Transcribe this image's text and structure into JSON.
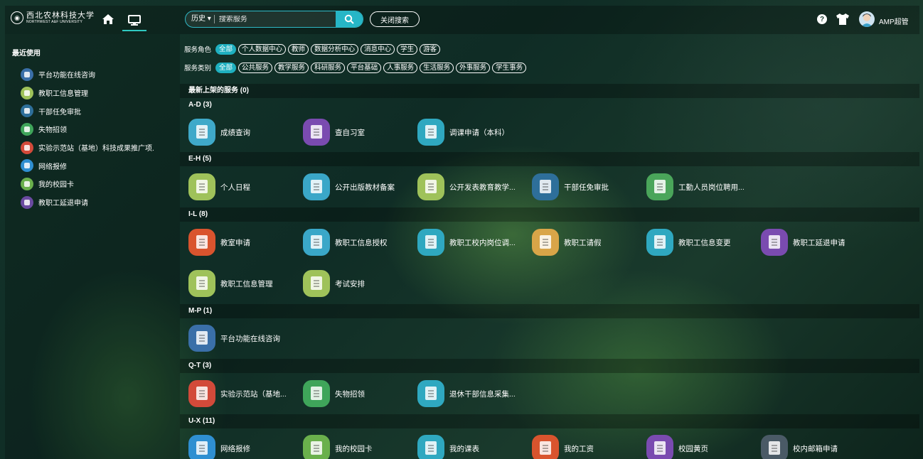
{
  "header": {
    "logo_cn": "西北农林科技大学",
    "logo_en": "NORTHWEST A&F UNIVERSITY",
    "history_label": "历史",
    "search_placeholder": "搜索服务",
    "close_search_label": "关闭搜索",
    "username": "AMP超管"
  },
  "sidebar": {
    "title": "最近使用",
    "items": [
      {
        "label": "平台功能在线咨询",
        "color": "#3a6fa8"
      },
      {
        "label": "教职工信息管理",
        "color": "#9fc25a"
      },
      {
        "label": "干部任免审批",
        "color": "#2e6f9a"
      },
      {
        "label": "失物招领",
        "color": "#3fa55a"
      },
      {
        "label": "实验示范站（基地）科技成果推广项.",
        "color": "#d24a3a"
      },
      {
        "label": "网络报修",
        "color": "#2f8fd1"
      },
      {
        "label": "我的校园卡",
        "color": "#6ab04c"
      },
      {
        "label": "教职工延退申请",
        "color": "#6a4aa0"
      }
    ]
  },
  "filters": {
    "role_label": "服务角色",
    "roles": [
      "全部",
      "个人数据中心",
      "教师",
      "数据分析中心",
      "消息中心",
      "学生",
      "游客"
    ],
    "type_label": "服务类别",
    "types": [
      "全部",
      "公共服务",
      "教学服务",
      "科研服务",
      "平台基础",
      "人事服务",
      "生活服务",
      "外事服务",
      "学生事务"
    ]
  },
  "sections": {
    "latest": "最新上架的服务 (0)",
    "ad": "A-D (3)",
    "eh": "E-H (5)",
    "il": "I-L (8)",
    "mp": "M-P (1)",
    "qt": "Q-T (3)",
    "ux": "U-X (11)"
  },
  "apps": {
    "ad": [
      {
        "label": "成绩查询",
        "color": "#3fa9c9"
      },
      {
        "label": "查自习室",
        "color": "#7a4bb0"
      },
      {
        "label": "调课申请（本科）",
        "color": "#2fa8c0"
      }
    ],
    "eh": [
      {
        "label": "个人日程",
        "color": "#9fc25a"
      },
      {
        "label": "公开出版教材备案",
        "color": "#3aa7c8"
      },
      {
        "label": "公开发表教育教学...",
        "color": "#9fc25a"
      },
      {
        "label": "干部任免审批",
        "color": "#2e6f9a"
      },
      {
        "label": "工勤人员岗位聘用...",
        "color": "#4aa55a"
      }
    ],
    "il1": [
      {
        "label": "教室申请",
        "color": "#d9542e"
      },
      {
        "label": "教职工信息授权",
        "color": "#3aa7c8"
      },
      {
        "label": "教职工校内岗位调...",
        "color": "#2fa8c0"
      },
      {
        "label": "教职工请假",
        "color": "#d9a548"
      },
      {
        "label": "教职工信息变更",
        "color": "#2fa8c0"
      },
      {
        "label": "教职工延退申请",
        "color": "#7a4bb0"
      }
    ],
    "il2": [
      {
        "label": "教职工信息管理",
        "color": "#9fc25a"
      },
      {
        "label": "考试安排",
        "color": "#9fc25a"
      }
    ],
    "mp": [
      {
        "label": "平台功能在线咨询",
        "color": "#3a6fa8"
      }
    ],
    "qt": [
      {
        "label": "实验示范站（基地...",
        "color": "#d24a3a"
      },
      {
        "label": "失物招领",
        "color": "#3fa55a"
      },
      {
        "label": "退休干部信息采集...",
        "color": "#2fa8c0"
      }
    ],
    "ux": [
      {
        "label": "网络报修",
        "color": "#2f8fd1"
      },
      {
        "label": "我的校园卡",
        "color": "#6ab04c"
      },
      {
        "label": "我的课表",
        "color": "#2fa8c0"
      },
      {
        "label": "我的工资",
        "color": "#d9542e"
      },
      {
        "label": "校园黄页",
        "color": "#7a4bb0"
      },
      {
        "label": "校内邮箱申请",
        "color": "#4a5a66"
      }
    ]
  }
}
